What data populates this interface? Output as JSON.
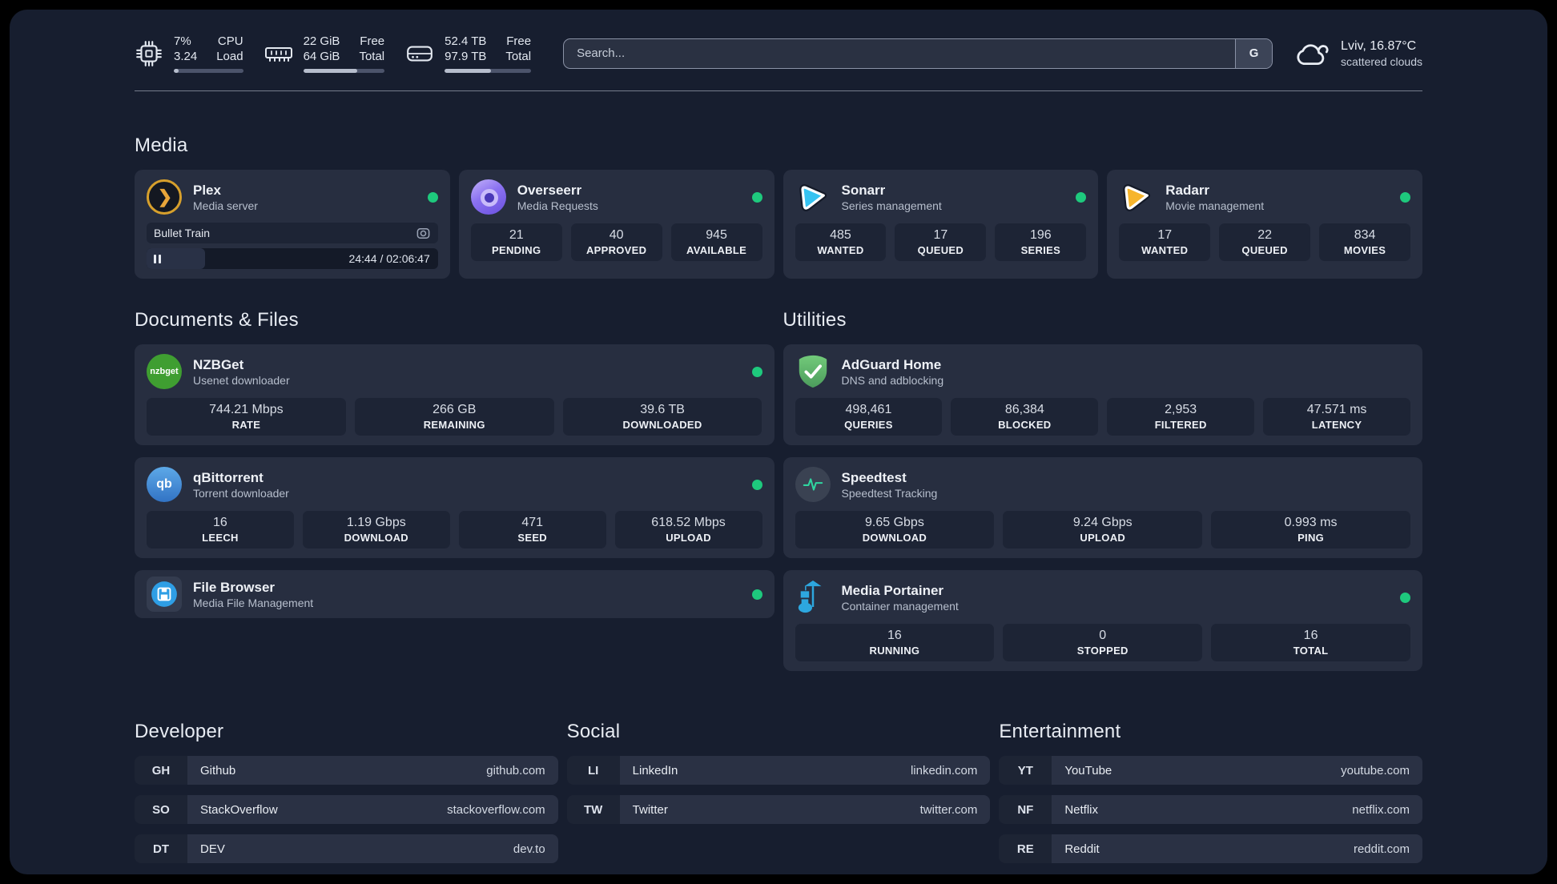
{
  "colors": {
    "background": "#171e2f",
    "card": "#272e40",
    "tile": "#1d2435",
    "accent_green": "#1ec97d",
    "plex_orange": "#d7a02c",
    "overseerr_purple": "#8a71f0",
    "sonarr_blue": "#36c3f1",
    "radarr_yellow": "#f7b52c",
    "nzbget_green": "#3f9e31",
    "adguard_green": "#67c26f",
    "qbittorrent_blue": "#4688c7",
    "speedtest_green": "#2fd6a0",
    "filebrowser_blue": "#2e9ee5",
    "portainer_blue": "#2da7df"
  },
  "icons": {
    "plex_glyph": "❯",
    "nzbget_label": "nzbget",
    "qbittorrent_label": "qb"
  },
  "header": {
    "system": [
      {
        "icon": "cpu-icon",
        "col1": [
          "7%",
          "3.24"
        ],
        "col2": [
          "CPU",
          "Load"
        ],
        "progress": 7
      },
      {
        "icon": "ram-icon",
        "col1": [
          "22 GiB",
          "64 GiB"
        ],
        "col2": [
          "Free",
          "Total"
        ],
        "progress": 66
      },
      {
        "icon": "disk-icon",
        "col1": [
          "52.4 TB",
          "97.9 TB"
        ],
        "col2": [
          "Free",
          "Total"
        ],
        "progress": 54
      }
    ],
    "search": {
      "placeholder": "Search...",
      "engine": "G"
    },
    "weather": {
      "icon": "cloud-icon",
      "title": "Lviv, 16.87°C",
      "subtitle": "scattered clouds"
    }
  },
  "media": {
    "title": "Media",
    "cards": [
      {
        "name": "Plex",
        "subtitle": "Media server",
        "icon": "plex-icon",
        "online": true,
        "player": {
          "track": "Bullet Train",
          "time": "24:44 / 02:06:47",
          "progress": 20
        }
      },
      {
        "name": "Overseerr",
        "subtitle": "Media Requests",
        "icon": "overseerr-icon",
        "online": true,
        "stats": [
          {
            "value": "21",
            "label": "PENDING"
          },
          {
            "value": "40",
            "label": "APPROVED"
          },
          {
            "value": "945",
            "label": "AVAILABLE"
          }
        ]
      },
      {
        "name": "Sonarr",
        "subtitle": "Series management",
        "icon": "sonarr-icon",
        "online": true,
        "stats": [
          {
            "value": "485",
            "label": "WANTED"
          },
          {
            "value": "17",
            "label": "QUEUED"
          },
          {
            "value": "196",
            "label": "SERIES"
          }
        ]
      },
      {
        "name": "Radarr",
        "subtitle": "Movie management",
        "icon": "radarr-icon",
        "online": true,
        "stats": [
          {
            "value": "17",
            "label": "WANTED"
          },
          {
            "value": "22",
            "label": "QUEUED"
          },
          {
            "value": "834",
            "label": "MOVIES"
          }
        ]
      }
    ]
  },
  "documents": {
    "title": "Documents & Files",
    "cards": [
      {
        "name": "NZBGet",
        "subtitle": "Usenet downloader",
        "icon": "nzbget-icon",
        "online": true,
        "stats": [
          {
            "value": "744.21 Mbps",
            "label": "RATE"
          },
          {
            "value": "266 GB",
            "label": "REMAINING"
          },
          {
            "value": "39.6 TB",
            "label": "DOWNLOADED"
          }
        ]
      },
      {
        "name": "qBittorrent",
        "subtitle": "Torrent downloader",
        "icon": "qbittorrent-icon",
        "online": true,
        "stats": [
          {
            "value": "16",
            "label": "LEECH"
          },
          {
            "value": "1.19 Gbps",
            "label": "DOWNLOAD"
          },
          {
            "value": "471",
            "label": "SEED"
          },
          {
            "value": "618.52 Mbps",
            "label": "UPLOAD"
          }
        ]
      },
      {
        "name": "File Browser",
        "subtitle": "Media File Management",
        "icon": "filebrowser-icon",
        "online": true,
        "stats": []
      }
    ]
  },
  "utilities": {
    "title": "Utilities",
    "cards": [
      {
        "name": "AdGuard Home",
        "subtitle": "DNS and adblocking",
        "icon": "adguard-icon",
        "online": false,
        "stats": [
          {
            "value": "498,461",
            "label": "QUERIES"
          },
          {
            "value": "86,384",
            "label": "BLOCKED"
          },
          {
            "value": "2,953",
            "label": "FILTERED"
          },
          {
            "value": "47.571 ms",
            "label": "LATENCY"
          }
        ]
      },
      {
        "name": "Speedtest",
        "subtitle": "Speedtest Tracking",
        "icon": "speedtest-icon",
        "online": false,
        "stats": [
          {
            "value": "9.65 Gbps",
            "label": "DOWNLOAD"
          },
          {
            "value": "9.24 Gbps",
            "label": "UPLOAD"
          },
          {
            "value": "0.993 ms",
            "label": "PING"
          }
        ]
      },
      {
        "name": "Media Portainer",
        "subtitle": "Container management",
        "icon": "portainer-icon",
        "online": true,
        "stats": [
          {
            "value": "16",
            "label": "RUNNING"
          },
          {
            "value": "0",
            "label": "STOPPED"
          },
          {
            "value": "16",
            "label": "TOTAL"
          }
        ]
      }
    ]
  },
  "bookmarks": {
    "sections": [
      {
        "title": "Developer",
        "items": [
          {
            "abbr": "GH",
            "name": "Github",
            "url": "github.com"
          },
          {
            "abbr": "SO",
            "name": "StackOverflow",
            "url": "stackoverflow.com"
          },
          {
            "abbr": "DT",
            "name": "DEV",
            "url": "dev.to"
          }
        ]
      },
      {
        "title": "Social",
        "items": [
          {
            "abbr": "LI",
            "name": "LinkedIn",
            "url": "linkedin.com"
          },
          {
            "abbr": "TW",
            "name": "Twitter",
            "url": "twitter.com"
          }
        ]
      },
      {
        "title": "Entertainment",
        "items": [
          {
            "abbr": "YT",
            "name": "YouTube",
            "url": "youtube.com"
          },
          {
            "abbr": "NF",
            "name": "Netflix",
            "url": "netflix.com"
          },
          {
            "abbr": "RE",
            "name": "Reddit",
            "url": "reddit.com"
          }
        ]
      }
    ]
  }
}
